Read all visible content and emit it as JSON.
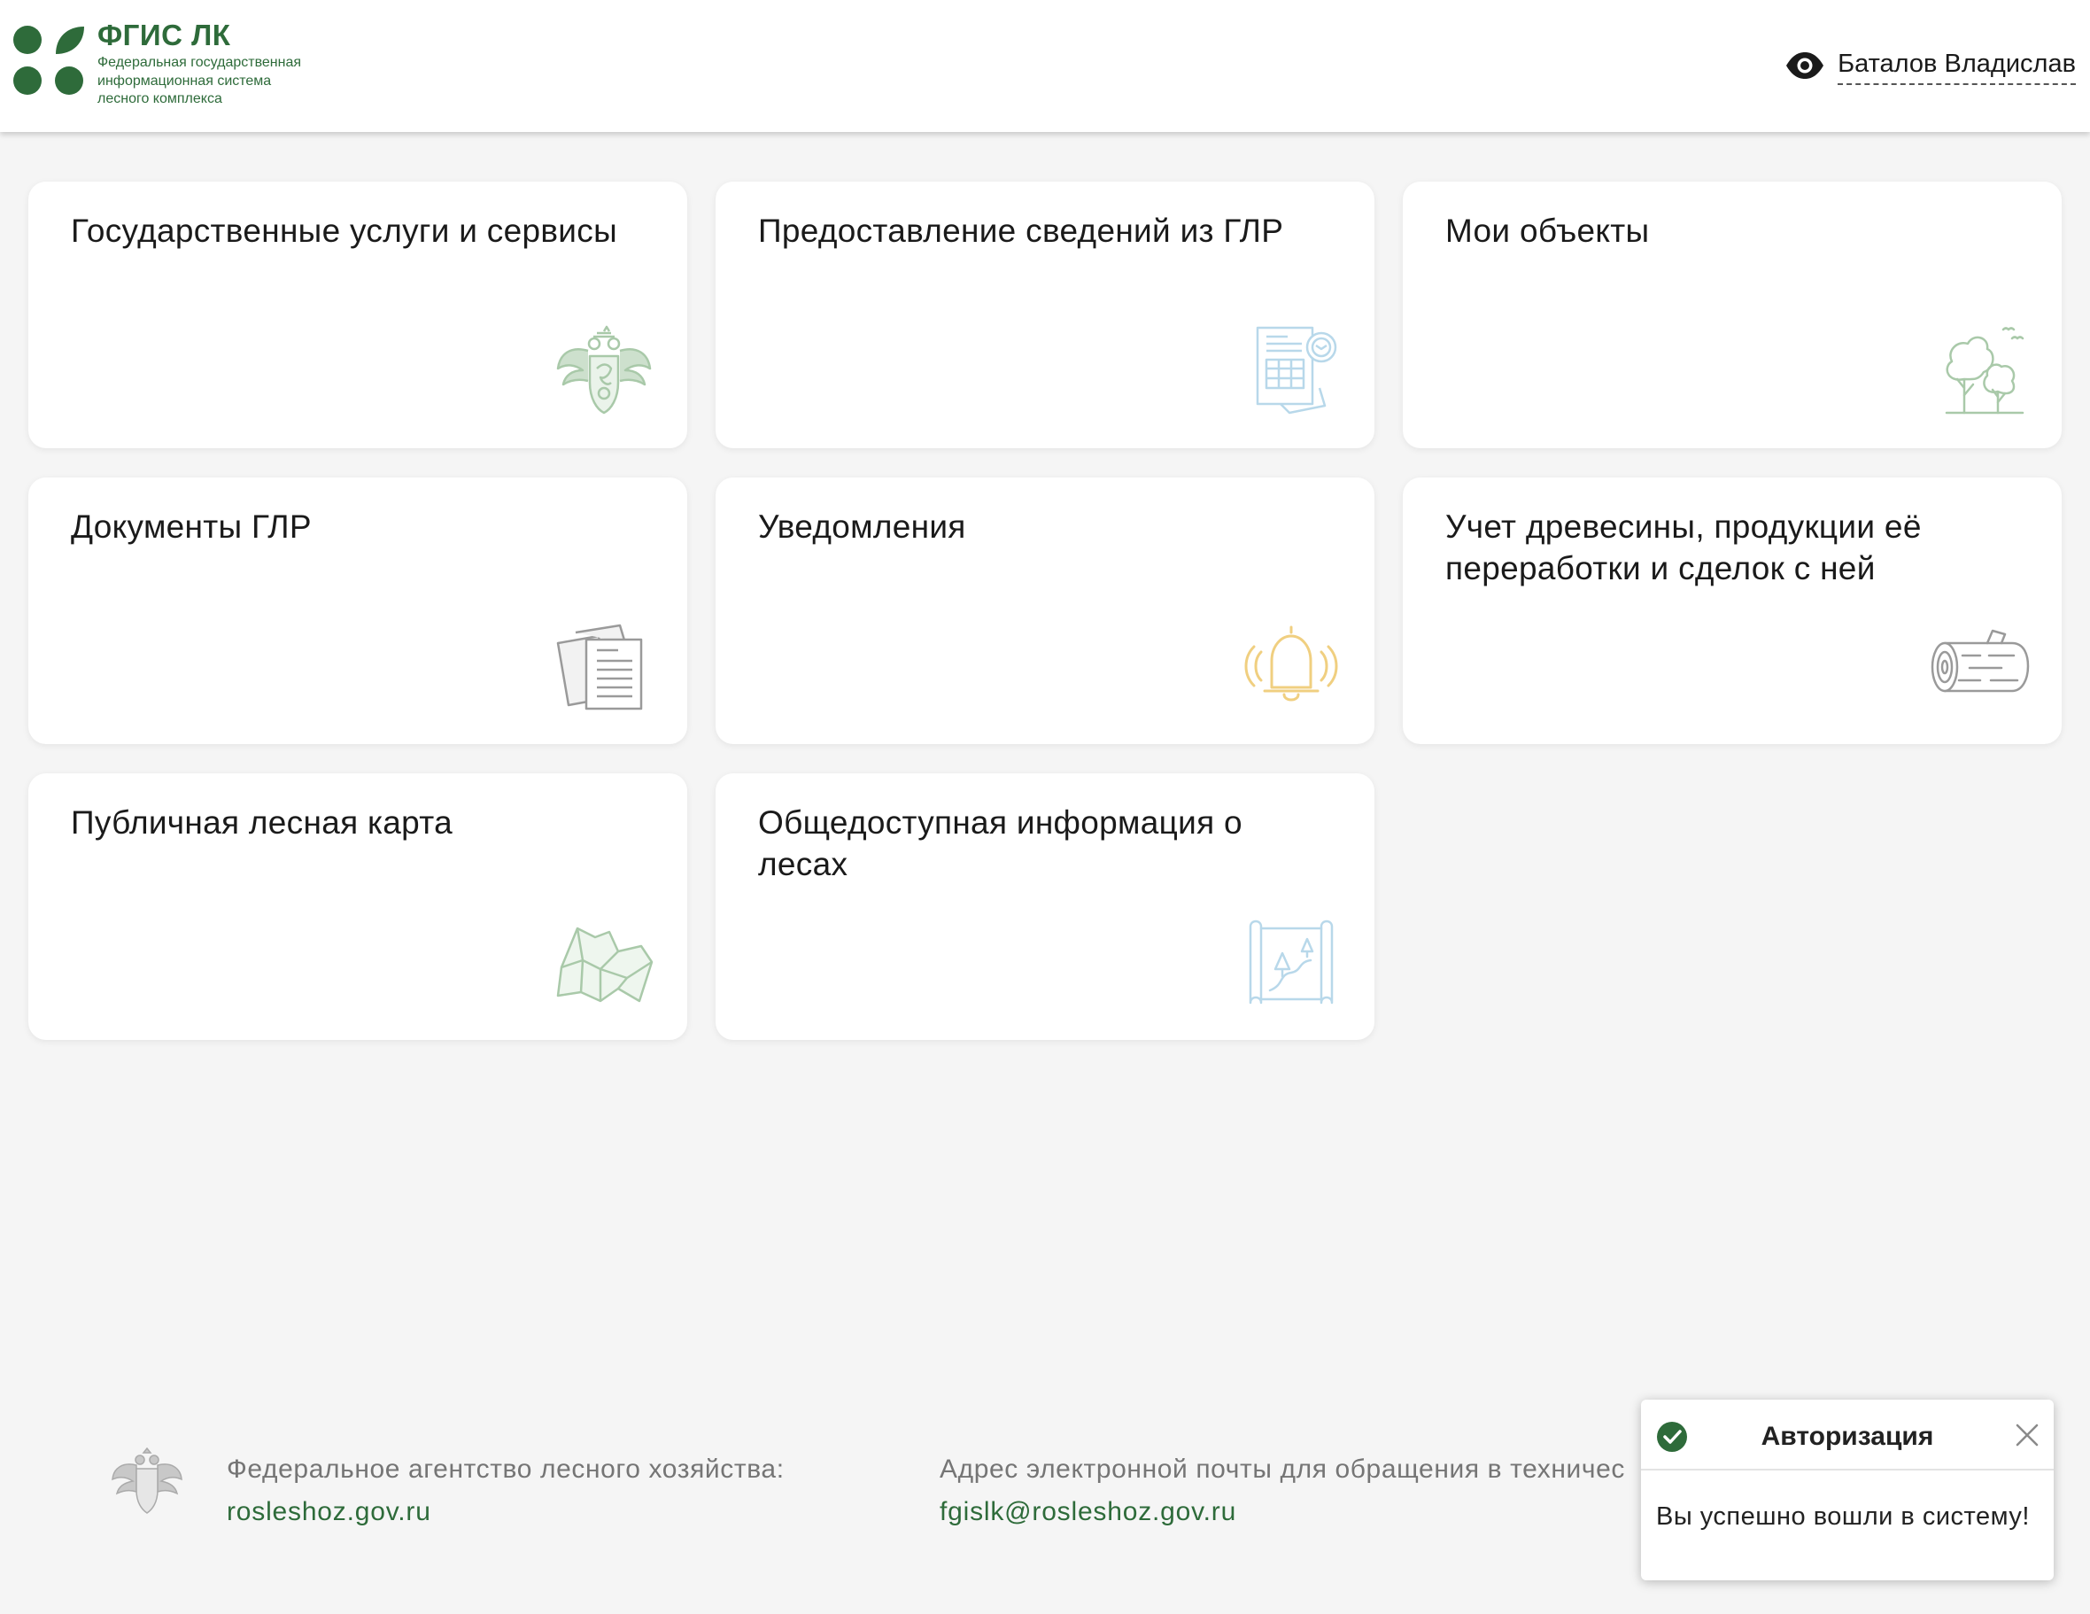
{
  "header": {
    "logo_title": "ФГИС ЛК",
    "logo_sub_line1": "Федеральная государственная",
    "logo_sub_line2": "информационная система",
    "logo_sub_line3": "лесного комплекса",
    "user_name": "Баталов Владислав"
  },
  "tiles": [
    {
      "title": "Государственные услуги и сервисы",
      "icon": "emblem-icon"
    },
    {
      "title": "Предоставление сведений из ГЛР",
      "icon": "document-table-icon"
    },
    {
      "title": "Мои объекты",
      "icon": "trees-icon"
    },
    {
      "title": "Документы ГЛР",
      "icon": "documents-icon"
    },
    {
      "title": "Уведомления",
      "icon": "bell-icon"
    },
    {
      "title": "Учет древесины, продукции её переработки и сделок с ней",
      "icon": "log-icon"
    },
    {
      "title": "Публичная лесная карта",
      "icon": "map-icon"
    },
    {
      "title": "Общедоступная информация о лесах",
      "icon": "scroll-map-icon"
    }
  ],
  "footer": {
    "agency_label": "Федеральное агентство лесного хозяйства:",
    "agency_link": "rosleshoz.gov.ru",
    "email_label": "Адрес электронной почты для обращения в техничес",
    "email_link": "fgislk@rosleshoz.gov.ru"
  },
  "toast": {
    "title": "Авторизация",
    "message": "Вы успешно вошли в систему!"
  },
  "colors": {
    "brand_green": "#2e6b3a",
    "background": "#f5f5f5",
    "icon_green": "#a9c9a9",
    "icon_blue": "#b8d8ea",
    "icon_gray": "#9a9a9a",
    "icon_yellow": "#f0cf80"
  }
}
